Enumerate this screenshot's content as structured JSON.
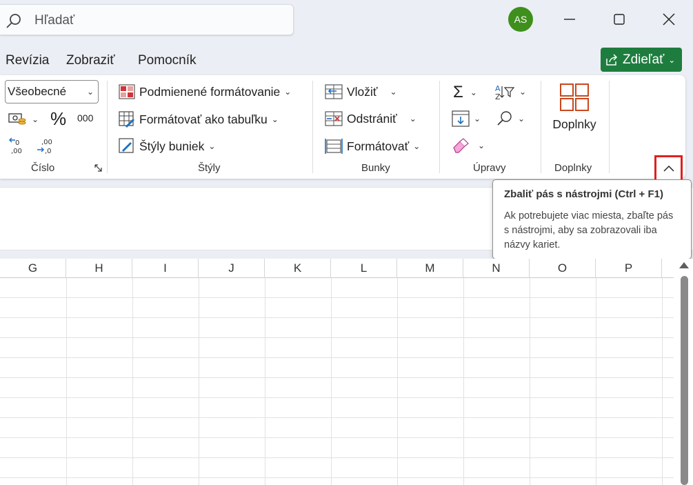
{
  "search": {
    "placeholder": "Hľadať"
  },
  "user": {
    "initials": "AS"
  },
  "tabs": [
    {
      "label": "Revízia"
    },
    {
      "label": "Zobraziť"
    },
    {
      "label": "Pomocník"
    }
  ],
  "share": {
    "label": "Zdieľať"
  },
  "number_group": {
    "format_value": "Všeobecné",
    "label": "Číslo"
  },
  "styles_group": {
    "conditional": "Podmienené formátovanie",
    "as_table": "Formátovať ako tabuľku",
    "cell_styles": "Štýly buniek",
    "label": "Štýly"
  },
  "cells_group": {
    "insert": "Vložiť",
    "delete": "Odstrániť",
    "format": "Formátovať",
    "label": "Bunky"
  },
  "editing_group": {
    "label": "Úpravy"
  },
  "addins_group": {
    "button": "Doplnky",
    "label": "Doplnky"
  },
  "tooltip": {
    "title": "Zbaliť pás s nástrojmi (Ctrl + F1)",
    "body": "Ak potrebujete viac miesta, zbaľte pás s nástrojmi, aby sa zobrazovali iba názvy kariet."
  },
  "columns": [
    "G",
    "H",
    "I",
    "J",
    "K",
    "L",
    "M",
    "N",
    "O",
    "P"
  ],
  "colors": {
    "accent": "#1e7d3e",
    "avatar": "#3e8f1c",
    "highlight": "#e02020"
  }
}
